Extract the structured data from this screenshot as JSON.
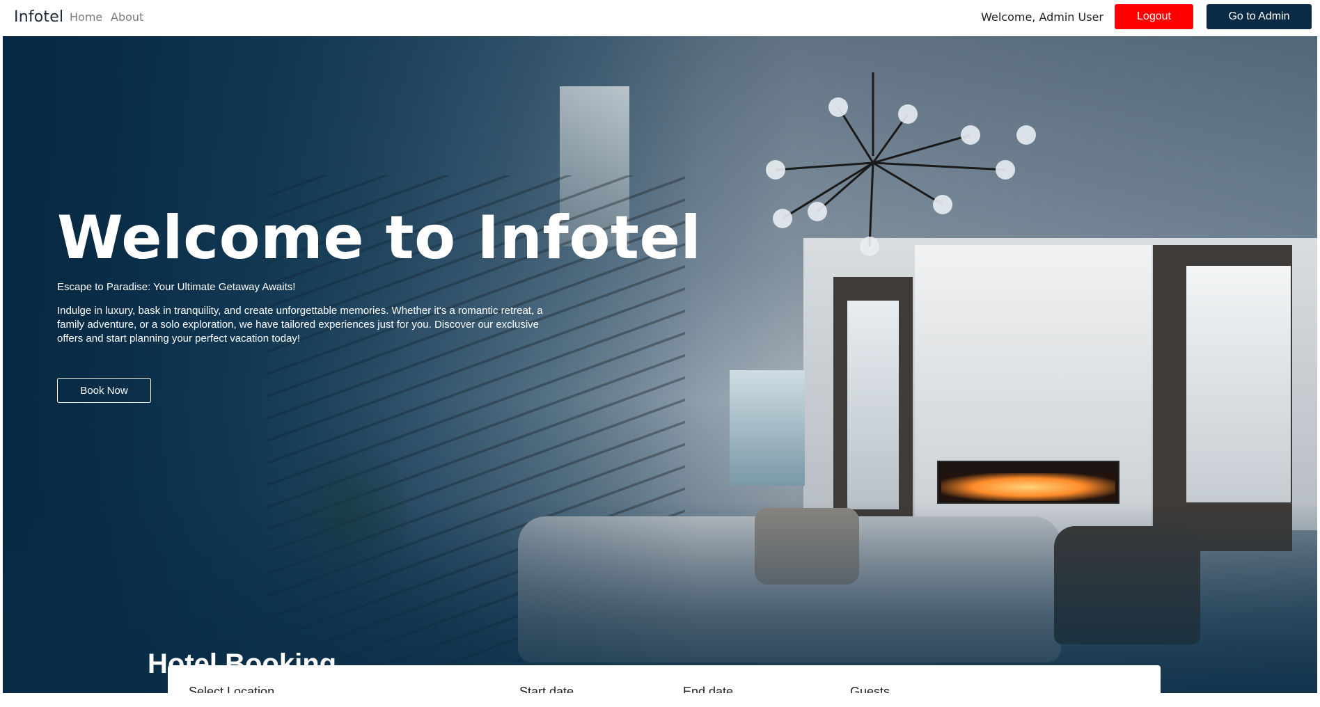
{
  "navbar": {
    "brand": "Infotel",
    "links": [
      {
        "label": "Home"
      },
      {
        "label": "About"
      }
    ],
    "welcome_text": "Welcome, Admin User",
    "logout_label": "Logout",
    "admin_label": "Go to Admin"
  },
  "hero": {
    "title": "Welcome to Infotel",
    "subtitle": "Escape to Paradise: Your Ultimate Getaway Awaits!",
    "body": "Indulge in luxury, bask in tranquility, and create unforgettable memories. Whether it's a romantic retreat, a family adventure, or a solo exploration, we have tailored experiences just for you. Discover our exclusive offers and start planning your perfect vacation today!",
    "cta_label": "Book Now"
  },
  "booking": {
    "title": "Hotel Booking",
    "fields": [
      {
        "label": "Select Location"
      },
      {
        "label": "Start date"
      },
      {
        "label": "End date"
      },
      {
        "label": "Guests"
      }
    ]
  },
  "colors": {
    "logout_bg": "#ff0000",
    "admin_bg": "#0b2a45",
    "hero_overlay": "#072a44"
  },
  "icons": {
    "chandelier": "chandelier-illustration"
  }
}
